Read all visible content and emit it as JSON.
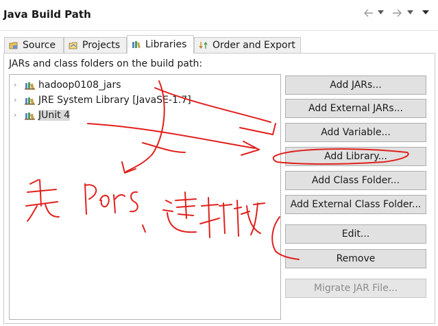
{
  "header": {
    "title": "Java Build Path"
  },
  "tabs": [
    {
      "label": "Source",
      "icon": "source-folder-icon",
      "active": false
    },
    {
      "label": "Projects",
      "icon": "projects-icon",
      "active": false
    },
    {
      "label": "Libraries",
      "icon": "libraries-icon",
      "active": true
    },
    {
      "label": "Order and Export",
      "icon": "order-export-icon",
      "active": false
    }
  ],
  "libraries": {
    "section_label": "JARs and class folders on the build path:",
    "items": [
      {
        "label": "hadoop0108_jars",
        "icon": "library-icon"
      },
      {
        "label": "JRE System Library [JavaSE-1.7]",
        "icon": "library-icon"
      },
      {
        "label": "JUnit 4",
        "icon": "library-icon",
        "selected": true
      }
    ]
  },
  "buttons": {
    "add_jars": "Add JARs...",
    "add_external_jars": "Add External JARs...",
    "add_variable": "Add Variable...",
    "add_library": "Add Library...",
    "add_class_folder": "Add Class Folder...",
    "add_external_class_folder": "Add External Class Folder...",
    "edit": "Edit...",
    "remove": "Remove",
    "migrate_jar": "Migrate JAR File..."
  },
  "colors": {
    "annotation_ink": "#e0201c",
    "selection": "#d9d9d9",
    "button_face": "#e1e1e1"
  }
}
